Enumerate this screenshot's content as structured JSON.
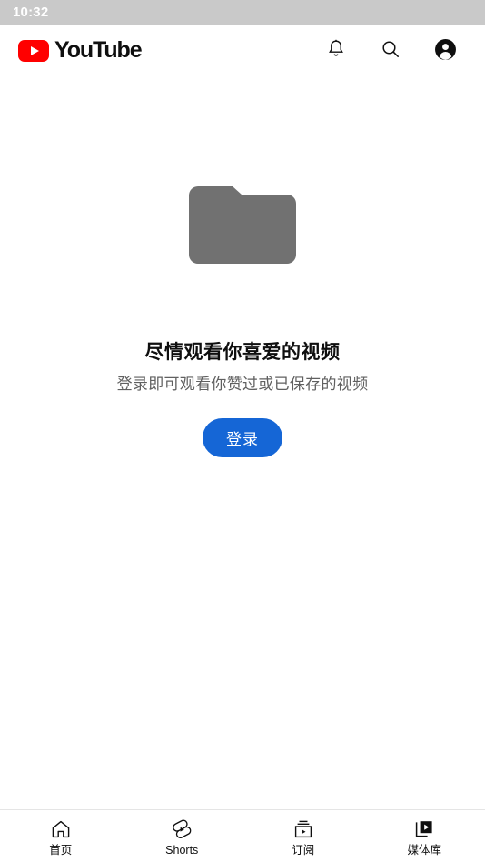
{
  "status_bar": {
    "time": "10:32",
    "background_color": "#c9c9c9",
    "text_color": "#ffffff"
  },
  "header": {
    "brand_name": "YouTube",
    "brand_color": "#ff0000",
    "actions": [
      {
        "name": "notifications",
        "icon": "bell-icon"
      },
      {
        "name": "search",
        "icon": "search-icon"
      },
      {
        "name": "account",
        "icon": "account-circle-icon"
      }
    ]
  },
  "main": {
    "illustration": "folder-icon",
    "illustration_color": "#717171",
    "title": "尽情观看你喜爱的视频",
    "subtitle": "登录即可观看你赞过或已保存的视频",
    "signin_label": "登录",
    "signin_color": "#1566d6"
  },
  "bottom_nav": {
    "items": [
      {
        "label": "首页",
        "icon": "home-icon",
        "active": false
      },
      {
        "label": "Shorts",
        "icon": "shorts-icon",
        "active": false
      },
      {
        "label": "订阅",
        "icon": "subscriptions-icon",
        "active": false
      },
      {
        "label": "媒体库",
        "icon": "library-icon",
        "active": true
      }
    ]
  }
}
